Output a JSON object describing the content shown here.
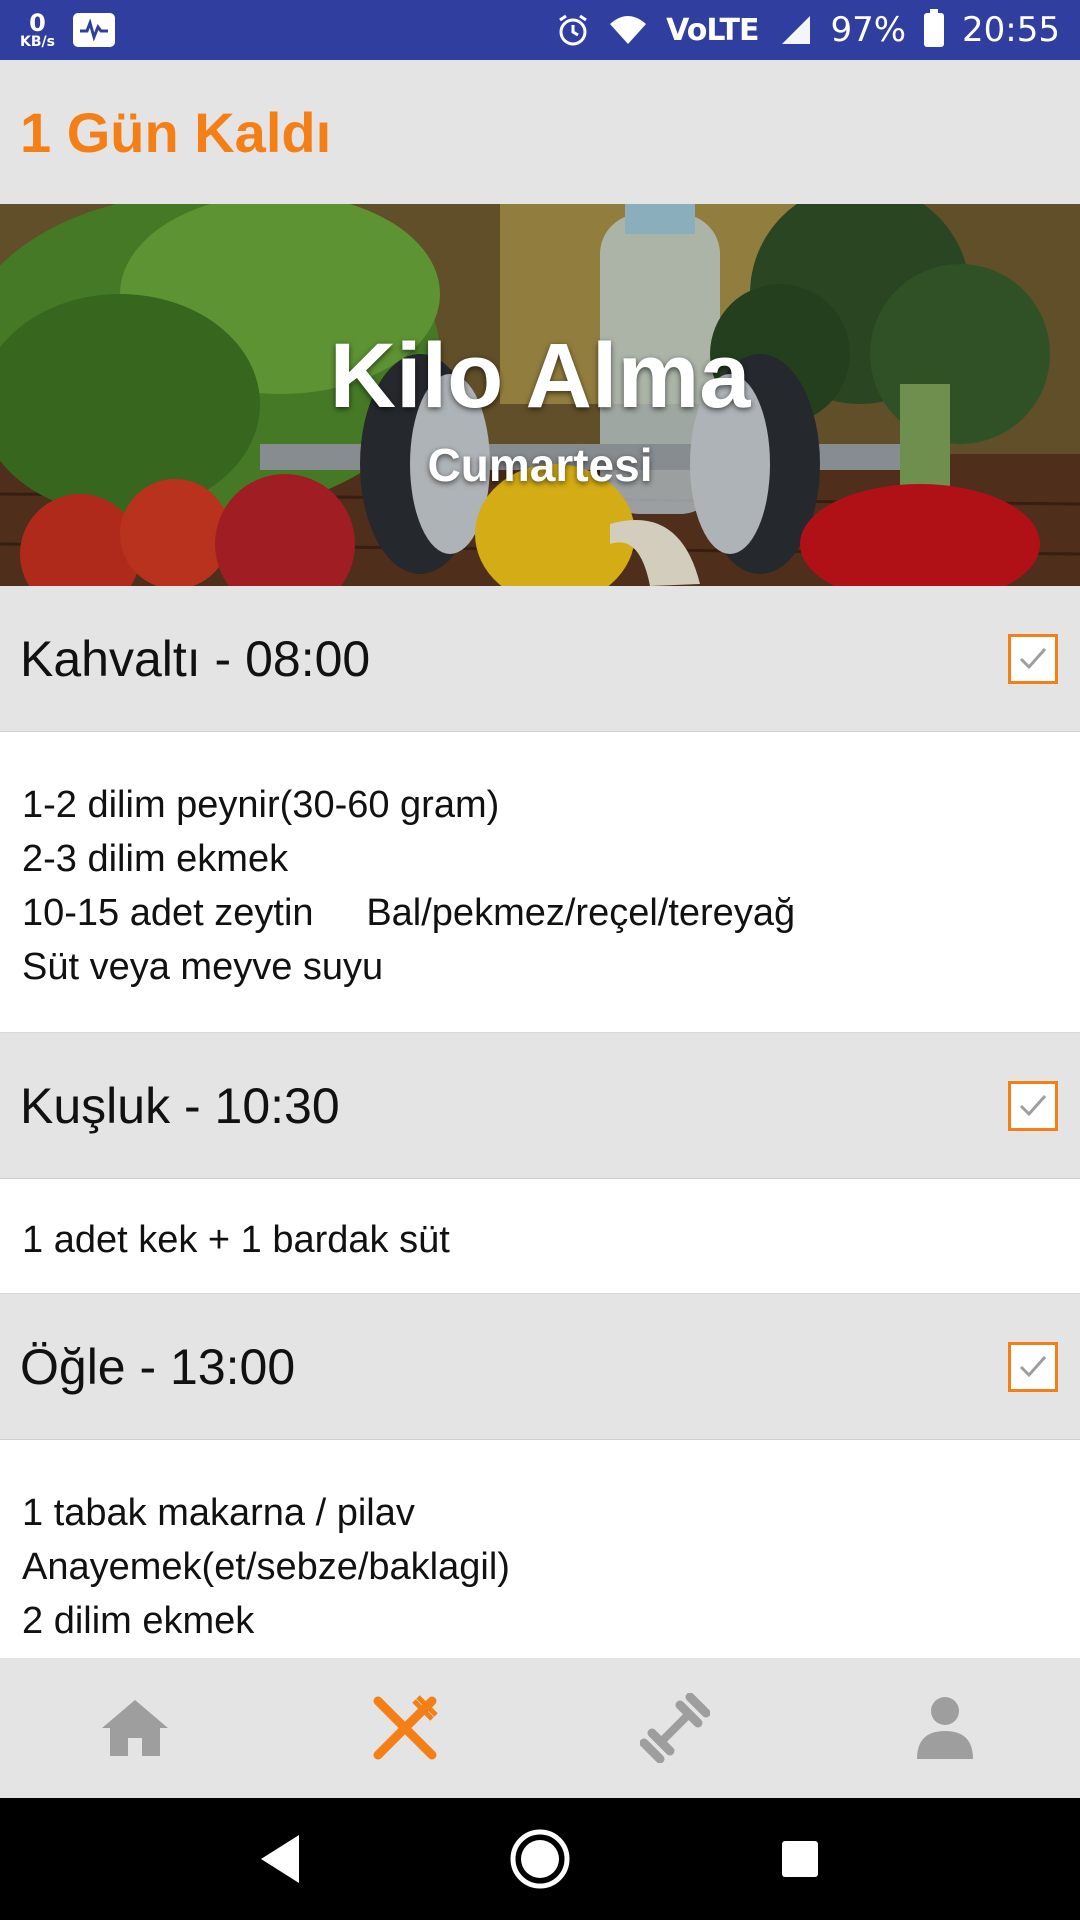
{
  "status_bar": {
    "speed_value": "0",
    "speed_unit": "KB/s",
    "network_label": "VoLTE",
    "battery": "97%",
    "time": "20:55"
  },
  "header": {
    "title": "1 Gün Kaldı"
  },
  "hero": {
    "title": "Kilo Alma",
    "subtitle": "Cumartesi"
  },
  "meals": [
    {
      "title": "Kahvaltı - 08:00",
      "checked": true,
      "lines": [
        "1-2 dilim peynir(30-60 gram)",
        "2-3 dilim ekmek",
        "10-15 adet zeytin     Bal/pekmez/reçel/tereyağ",
        "Süt veya meyve suyu"
      ]
    },
    {
      "title": "Kuşluk - 10:30",
      "checked": true,
      "lines": [
        "1 adet kek + 1 bardak süt"
      ]
    },
    {
      "title": "Öğle - 13:00",
      "checked": true,
      "lines": [
        "1 tabak makarna / pilav",
        "Anayemek(et/sebze/baklagil)",
        "2 dilim ekmek"
      ]
    }
  ],
  "bottom_nav": {
    "items": [
      {
        "icon": "home-icon",
        "active": false
      },
      {
        "icon": "fork-knife-icon",
        "active": true
      },
      {
        "icon": "dumbbell-icon",
        "active": false
      },
      {
        "icon": "person-icon",
        "active": false
      }
    ]
  },
  "colors": {
    "accent": "#f57f17",
    "status_bar": "#303f9f",
    "header_bg": "#e4e4e4",
    "nav_inactive": "#9e9e9e"
  }
}
